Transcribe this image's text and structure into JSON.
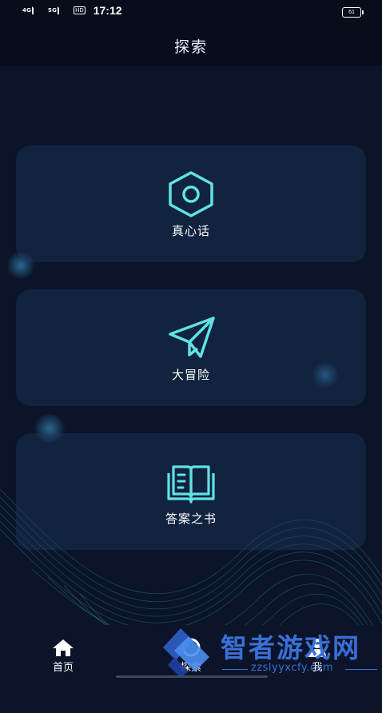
{
  "status_bar": {
    "signal_1": "4G",
    "signal_2": "5G",
    "hd_badge": "HD",
    "time": "17:12",
    "battery": "61"
  },
  "header": {
    "title": "探索"
  },
  "cards": [
    {
      "label": "真心话",
      "icon": "hexagon-nut-icon"
    },
    {
      "label": "大冒险",
      "icon": "paper-plane-icon"
    },
    {
      "label": "答案之书",
      "icon": "open-book-icon"
    }
  ],
  "tabs": [
    {
      "label": "首页",
      "icon": "home-icon"
    },
    {
      "label": "探索",
      "icon": "explore-icon"
    },
    {
      "label": "我",
      "icon": "profile-icon"
    }
  ],
  "watermark": {
    "text": "智者游戏网",
    "url": "zzslyyxcfy.com"
  },
  "colors": {
    "accent_cyan": "#5fe3e6",
    "background": "#0b1428",
    "card": "#14284a"
  }
}
